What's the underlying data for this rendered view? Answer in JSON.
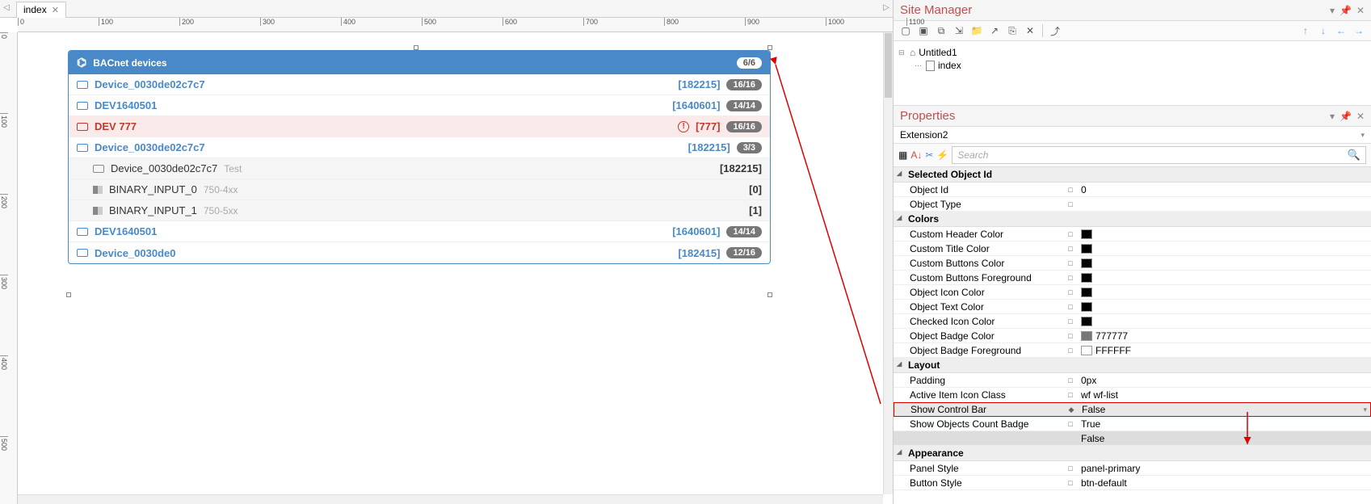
{
  "tab": {
    "label": "index"
  },
  "ruler_h": [
    0,
    100,
    200,
    300,
    400,
    500,
    600,
    700,
    800,
    900,
    1000,
    1100
  ],
  "ruler_v": [
    0,
    100,
    200,
    300,
    400,
    500
  ],
  "widget": {
    "title": "BACnet devices",
    "badge": "6/6",
    "rows": [
      {
        "type": "dev",
        "name": "Device_0030de02c7c7",
        "id": "[182215]",
        "badge": "16/16"
      },
      {
        "type": "dev",
        "name": "DEV1640501",
        "id": "[1640601]",
        "badge": "14/14"
      },
      {
        "type": "err",
        "name": "DEV 777",
        "id": "[777]",
        "badge": "16/16"
      },
      {
        "type": "dev",
        "name": "Device_0030de02c7c7",
        "id": "[182215]",
        "badge": "3/3"
      },
      {
        "type": "sub",
        "name": "Device_0030de02c7c7",
        "suffix": "Test",
        "id": "[182215]"
      },
      {
        "type": "bin",
        "name": "BINARY_INPUT_0",
        "suffix": "750-4xx",
        "id": "[0]"
      },
      {
        "type": "bin",
        "name": "BINARY_INPUT_1",
        "suffix": "750-5xx",
        "id": "[1]"
      },
      {
        "type": "dev",
        "name": "DEV1640501",
        "id": "[1640601]",
        "badge": "14/14"
      },
      {
        "type": "dev",
        "name": "Device_0030de0",
        "id": "[182415]",
        "badge": "12/16"
      }
    ]
  },
  "site_manager": {
    "title": "Site Manager",
    "tree": {
      "root": "Untitled1",
      "child": "index"
    }
  },
  "properties": {
    "title": "Properties",
    "extension": "Extension2",
    "search_placeholder": "Search",
    "groups": [
      {
        "cat": "Selected Object Id",
        "rows": [
          {
            "name": "Object Id",
            "val": "0",
            "marker": "□"
          },
          {
            "name": "Object Type",
            "val": "",
            "marker": "□"
          }
        ]
      },
      {
        "cat": "Colors",
        "rows": [
          {
            "name": "Custom Header Color",
            "swatch": "black",
            "marker": "□"
          },
          {
            "name": "Custom Title Color",
            "swatch": "black",
            "marker": "□"
          },
          {
            "name": "Custom Buttons Color",
            "swatch": "black",
            "marker": "□"
          },
          {
            "name": "Custom Buttons Foreground",
            "swatch": "black",
            "marker": "□"
          },
          {
            "name": "Object Icon Color",
            "swatch": "black",
            "marker": "□"
          },
          {
            "name": "Object Text Color",
            "swatch": "black",
            "marker": "□"
          },
          {
            "name": "Checked Icon Color",
            "swatch": "black",
            "marker": "□"
          },
          {
            "name": "Object Badge Color",
            "swatch": "grey",
            "val": "777777",
            "marker": "□"
          },
          {
            "name": "Object Badge Foreground",
            "swatch": "white",
            "val": "FFFFFF",
            "marker": "□"
          }
        ]
      },
      {
        "cat": "Layout",
        "rows": [
          {
            "name": "Padding",
            "val": "0px",
            "marker": "□"
          },
          {
            "name": "Active Item Icon Class",
            "val": "wf wf-list",
            "marker": "□"
          },
          {
            "name": "Show Control Bar",
            "val": "False",
            "marker": "◆",
            "hl": true,
            "dd": true
          },
          {
            "name": "Show Objects Count Badge",
            "val": "True",
            "marker": "□",
            "dd_open": "False"
          }
        ]
      },
      {
        "cat": "Appearance",
        "rows": [
          {
            "name": "Panel Style",
            "val": "panel-primary",
            "marker": "□"
          },
          {
            "name": "Button Style",
            "val": "btn-default",
            "marker": "□"
          }
        ]
      }
    ]
  }
}
